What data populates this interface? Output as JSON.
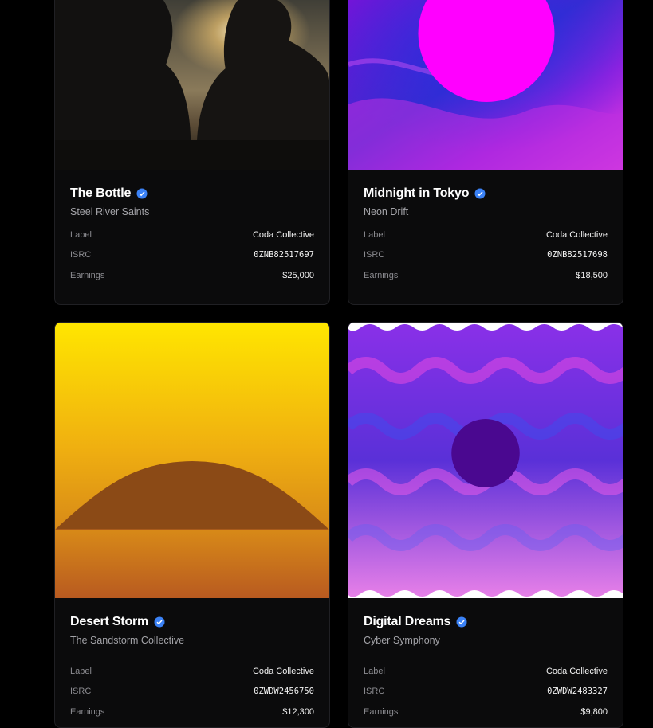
{
  "cards": [
    {
      "title": "The Bottle",
      "artist": "Steel River Saints",
      "label_key": "Label",
      "label_value": "Coda Collective",
      "isrc_key": "ISRC",
      "isrc_value": "0ZNB82517697",
      "earnings_key": "Earnings",
      "earnings_value": "$25,000",
      "artwork": "silhouette-couple-sunset"
    },
    {
      "title": "Midnight in Tokyo",
      "artist": "Neon Drift",
      "label_key": "Label",
      "label_value": "Coda Collective",
      "isrc_key": "ISRC",
      "isrc_value": "0ZNB82517698",
      "earnings_key": "Earnings",
      "earnings_value": "$18,500",
      "artwork": "magenta-circle-swirl"
    },
    {
      "title": "Desert Storm",
      "artist": "The Sandstorm Collective",
      "label_key": "Label",
      "label_value": "Coda Collective",
      "isrc_key": "ISRC",
      "isrc_value": "0ZWDW2456750",
      "earnings_key": "Earnings",
      "earnings_value": "$12,300",
      "artwork": "desert-dune-sunset"
    },
    {
      "title": "Digital Dreams",
      "artist": "Cyber Symphony",
      "label_key": "Label",
      "label_value": "Coda Collective",
      "isrc_key": "ISRC",
      "isrc_value": "0ZWDW2483327",
      "earnings_key": "Earnings",
      "earnings_value": "$9,800",
      "artwork": "purple-wave-circle"
    }
  ],
  "colors": {
    "background": "#000000",
    "card": "#0b0b0c",
    "verified": "#3b82f6"
  },
  "icons": {
    "verified": "verified-check-icon"
  }
}
